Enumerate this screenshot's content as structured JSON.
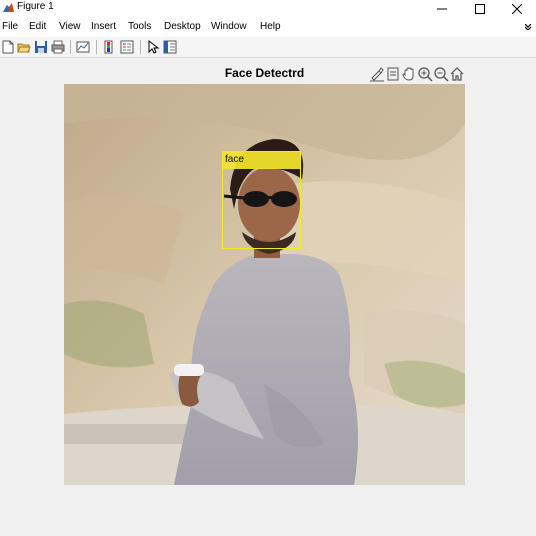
{
  "window": {
    "title": "Figure 1",
    "controls": {
      "minimize": "–",
      "maximize": "☐",
      "close": "✕"
    }
  },
  "menubar": {
    "items": [
      {
        "label": "File"
      },
      {
        "label": "Edit"
      },
      {
        "label": "View"
      },
      {
        "label": "Insert"
      },
      {
        "label": "Tools"
      },
      {
        "label": "Desktop"
      },
      {
        "label": "Window"
      },
      {
        "label": "Help"
      }
    ],
    "overflow_icon": "chevron-icon"
  },
  "toolbar": {
    "buttons": [
      {
        "name": "new-figure-icon"
      },
      {
        "name": "open-file-icon"
      },
      {
        "name": "save-icon"
      },
      {
        "name": "print-icon"
      },
      {
        "name": "link-plot-icon"
      },
      {
        "name": "insert-colorbar-icon"
      },
      {
        "name": "insert-legend-icon"
      },
      {
        "name": "pointer-icon"
      },
      {
        "name": "property-inspector-icon"
      }
    ]
  },
  "axes_toolbar": {
    "buttons": [
      {
        "name": "brush-icon"
      },
      {
        "name": "data-tips-icon"
      },
      {
        "name": "pan-icon"
      },
      {
        "name": "zoom-in-icon"
      },
      {
        "name": "zoom-out-icon"
      },
      {
        "name": "home-icon"
      }
    ]
  },
  "plot": {
    "title": "Face Detectrd",
    "annotation_label": "face",
    "annotation_color": "#f4e52b"
  }
}
